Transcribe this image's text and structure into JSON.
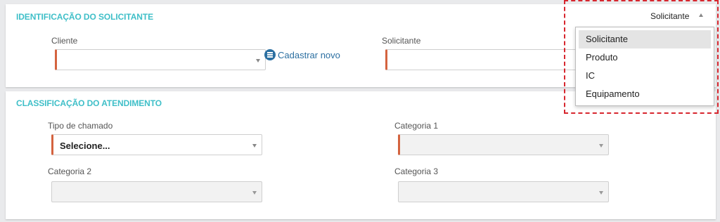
{
  "identificacao": {
    "title": "IDENTIFICAÇÃO DO SOLICITANTE",
    "cliente_label": "Cliente",
    "cliente_value": "",
    "cadastrar_label": "Cadastrar novo",
    "solicitante_label": "Solicitante",
    "solicitante_value": ""
  },
  "classificacao": {
    "title": "CLASSIFICAÇÃO DO ATENDIMENTO",
    "tipo_label": "Tipo de chamado",
    "tipo_value": "Selecione...",
    "categoria1_label": "Categoria 1",
    "categoria1_value": "",
    "categoria2_label": "Categoria 2",
    "categoria2_value": "",
    "categoria3_label": "Categoria 3",
    "categoria3_value": ""
  },
  "type_dropdown": {
    "selected": "Solicitante",
    "options": [
      "Solicitante",
      "Produto",
      "IC",
      "Equipamento"
    ]
  },
  "colors": {
    "accent_title": "#3fbfc8",
    "required_marker": "#d4633f",
    "link": "#2b6fa1",
    "highlight_border": "#d7262e"
  },
  "icons": {
    "cadastrar": "list-circle-icon"
  }
}
